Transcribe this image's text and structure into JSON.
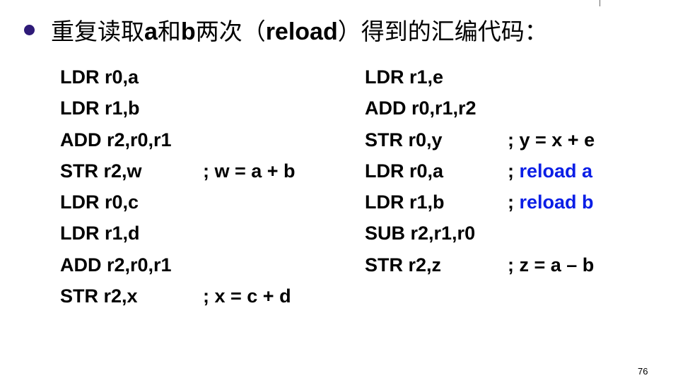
{
  "slide": {
    "bullet_icon": "filled-circle",
    "title": {
      "p1": "重复读取",
      "a": "a",
      "p2": "和",
      "b": "b",
      "p3": "两次（",
      "reload": "reload",
      "p4": "）得到的汇编代码："
    },
    "left_code": [
      {
        "instr": "LDR r0,a",
        "comment": ""
      },
      {
        "instr": "LDR r1,b",
        "comment": ""
      },
      {
        "instr": "ADD r2,r0,r1",
        "comment": ""
      },
      {
        "instr": "STR r2,w",
        "comment": "; w = a + b"
      },
      {
        "instr": "LDR r0,c",
        "comment": ""
      },
      {
        "instr": "LDR r1,d",
        "comment": ""
      },
      {
        "instr": "ADD r2,r0,r1",
        "comment": ""
      },
      {
        "instr": "STR r2,x",
        "comment": "; x = c + d"
      }
    ],
    "right_code": [
      {
        "instr": "LDR r1,e",
        "comment_prefix": "",
        "comment": ""
      },
      {
        "instr": "ADD r0,r1,r2",
        "comment_prefix": "",
        "comment": ""
      },
      {
        "instr": "STR r0,y",
        "comment_prefix": "; ",
        "comment": "y = x + e"
      },
      {
        "instr": "LDR r0,a",
        "comment_prefix": "; ",
        "comment": "reload a"
      },
      {
        "instr": "LDR r1,b",
        "comment_prefix": "; ",
        "comment": "reload b"
      },
      {
        "instr": "SUB r2,r1,r0",
        "comment_prefix": "",
        "comment": ""
      },
      {
        "instr": "STR r2,z",
        "comment_prefix": "; ",
        "comment": "z = a – b"
      }
    ],
    "page_number": "76",
    "colors": {
      "bullet": "#2e1a78",
      "highlight": "#0a1ee6",
      "text": "#000000"
    }
  }
}
